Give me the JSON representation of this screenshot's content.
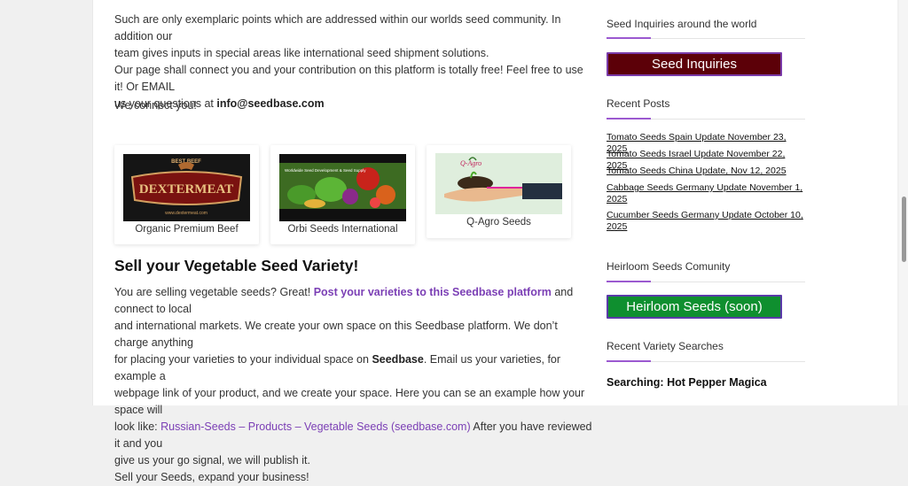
{
  "main": {
    "intro_lines": [
      "Such are only exemplaric points which are addressed within our worlds seed community. In addition our",
      "team gives inputs in special areas like international seed shipment solutions.",
      "Our page shall connect you and your contribution on this platform is totally free! Feel free to use it! Or EMAIL",
      "us your questions at "
    ],
    "email": "info@seedbase.com",
    "connect_text": "We connect you!",
    "partners": [
      {
        "name": "Organic Premium Beef",
        "logo_top": "BEST BEEF",
        "logo_word": "DEXTERMEAT",
        "logo_url": "www.dextermeat.com"
      },
      {
        "name": "Orbi Seeds International",
        "logo_text": "Worldwide Seed Development & Seed Supply"
      },
      {
        "name": "Q-Agro Seeds",
        "logo_text": "Q-Agro"
      }
    ],
    "sell_heading": "Sell your Vegetable Seed Variety!",
    "sell": {
      "p1_a": "You are selling vegetable seeds? Great! ",
      "p1_link": "Post your varieties to this Seedbase platform",
      "p1_b": " and connect to local",
      "l2": "and international markets. We create your own space on this Seedbase platform. We don’t charge anything",
      "l3_a": "for placing your varieties to your individual space on ",
      "l3_bold": "Seedbase",
      "l3_b": ". Email us your varieties, for example a",
      "l4": "webpage link of your product,  and we create your space. Here you can se an example how your space will",
      "l5_a": "look like: ",
      "l5_link": "Russian-Seeds – Products – Vegetable Seeds (seedbase.com)",
      "l5_b": "  After you have reviewed it and you",
      "l6": "give us your go signal, we will publish it.",
      "l7": "Sell your Seeds, expand your business!"
    }
  },
  "sidebar": {
    "inquiries_title": "Seed Inquiries around the world",
    "inquiries_button": "Seed Inquiries",
    "recent_posts_title": "Recent Posts",
    "posts": [
      "Tomato Seeds Spain Update November 23, 2025",
      "Tomato Seeds Israel Update November 22, 2025",
      "Tomato Seeds China Update, Nov 12, 2025",
      "Cabbage Seeds Germany Update November 1, 2025",
      "Cucumber Seeds Germany Update October 10, 2025"
    ],
    "heirloom_title": "Heirloom Seeds Comunity",
    "heirloom_button": "Heirloom Seeds (soon)",
    "searches_title": "Recent Variety Searches",
    "search_item": "Searching: Hot Pepper Magica"
  },
  "colors": {
    "inquiries_btn_bg": "#5c0008",
    "heirloom_btn_bg": "#0f8f2f",
    "accent": "#9b59d0",
    "link": "#7b3fb5"
  }
}
